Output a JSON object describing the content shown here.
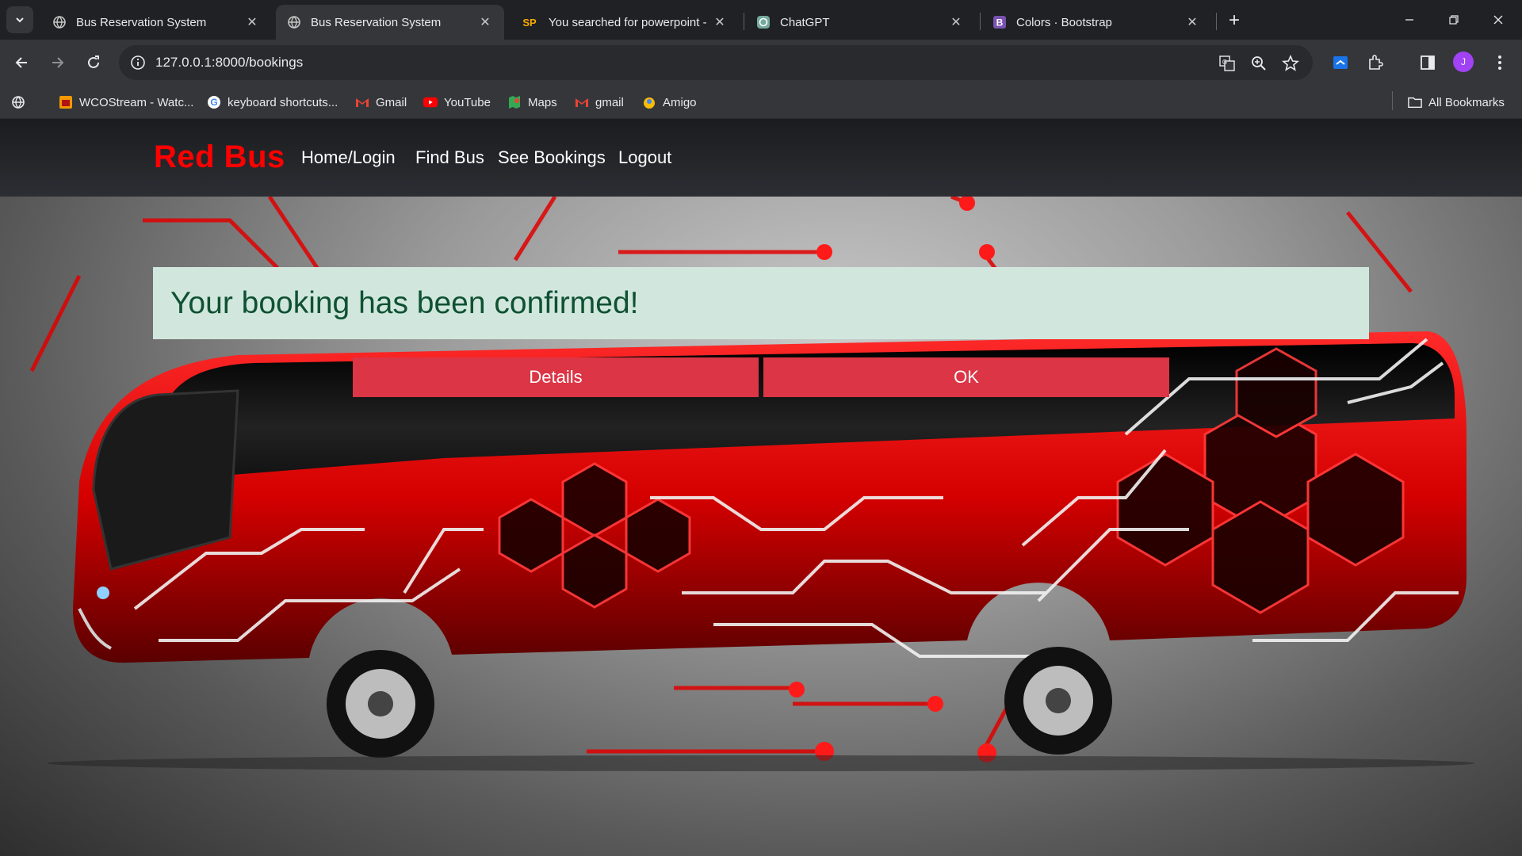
{
  "browser": {
    "tabs": [
      {
        "title": "Bus Reservation System",
        "icon": "globe-icon"
      },
      {
        "title": "Bus Reservation System",
        "icon": "globe-icon"
      },
      {
        "title": "You searched for powerpoint - ",
        "icon": "sp-favicon-icon"
      },
      {
        "title": "ChatGPT",
        "icon": "chatgpt-icon"
      },
      {
        "title": "Colors · Bootstrap",
        "icon": "bootstrap-icon"
      }
    ],
    "url": "127.0.0.1:8000/bookings",
    "avatar_initial": "J",
    "bookmarks": [
      {
        "label": "WCOStream - Watc...",
        "icon": "wcostream-icon"
      },
      {
        "label": "keyboard shortcuts...",
        "icon": "google-icon"
      },
      {
        "label": "Gmail",
        "icon": "gmail-icon"
      },
      {
        "label": "YouTube",
        "icon": "youtube-icon"
      },
      {
        "label": "Maps",
        "icon": "maps-icon"
      },
      {
        "label": "gmail",
        "icon": "gmail-icon"
      },
      {
        "label": "Amigo",
        "icon": "amigo-icon"
      }
    ],
    "all_bookmarks": "All Bookmarks"
  },
  "site": {
    "brand": "Red Bus",
    "nav": [
      "Home/Login",
      "Find Bus",
      "See Bookings",
      "Logout"
    ]
  },
  "alert": {
    "message": "Your booking has been confirmed!"
  },
  "buttons": {
    "details": "Details",
    "ok": "OK"
  },
  "colors": {
    "brand": "#ff0000",
    "alert_bg": "#d1e7dd",
    "alert_text": "#0f5132",
    "button": "#dc3545"
  }
}
